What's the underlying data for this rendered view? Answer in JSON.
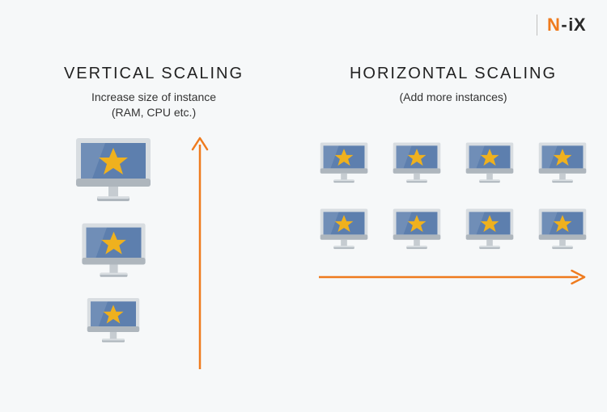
{
  "logo": {
    "part1": "N",
    "dash": "-",
    "part2": "iX"
  },
  "vertical": {
    "title": "VERTICAL SCALING",
    "subtitle_l1": "Increase size of instance",
    "subtitle_l2": "(RAM, CPU etc.)",
    "monitors": [
      {
        "size": "lg"
      },
      {
        "size": "md"
      },
      {
        "size": "sm"
      }
    ]
  },
  "horizontal": {
    "title": "HORIZONTAL SCALING",
    "subtitle": "(Add more instances)",
    "monitors_count": 8
  },
  "colors": {
    "accent": "#ef7b1e",
    "screen": "#5d7fae",
    "star": "#efb11e",
    "bezel": "#d8dde1",
    "bezel_dark": "#aeb6bd",
    "stand": "#c6ccd1"
  }
}
